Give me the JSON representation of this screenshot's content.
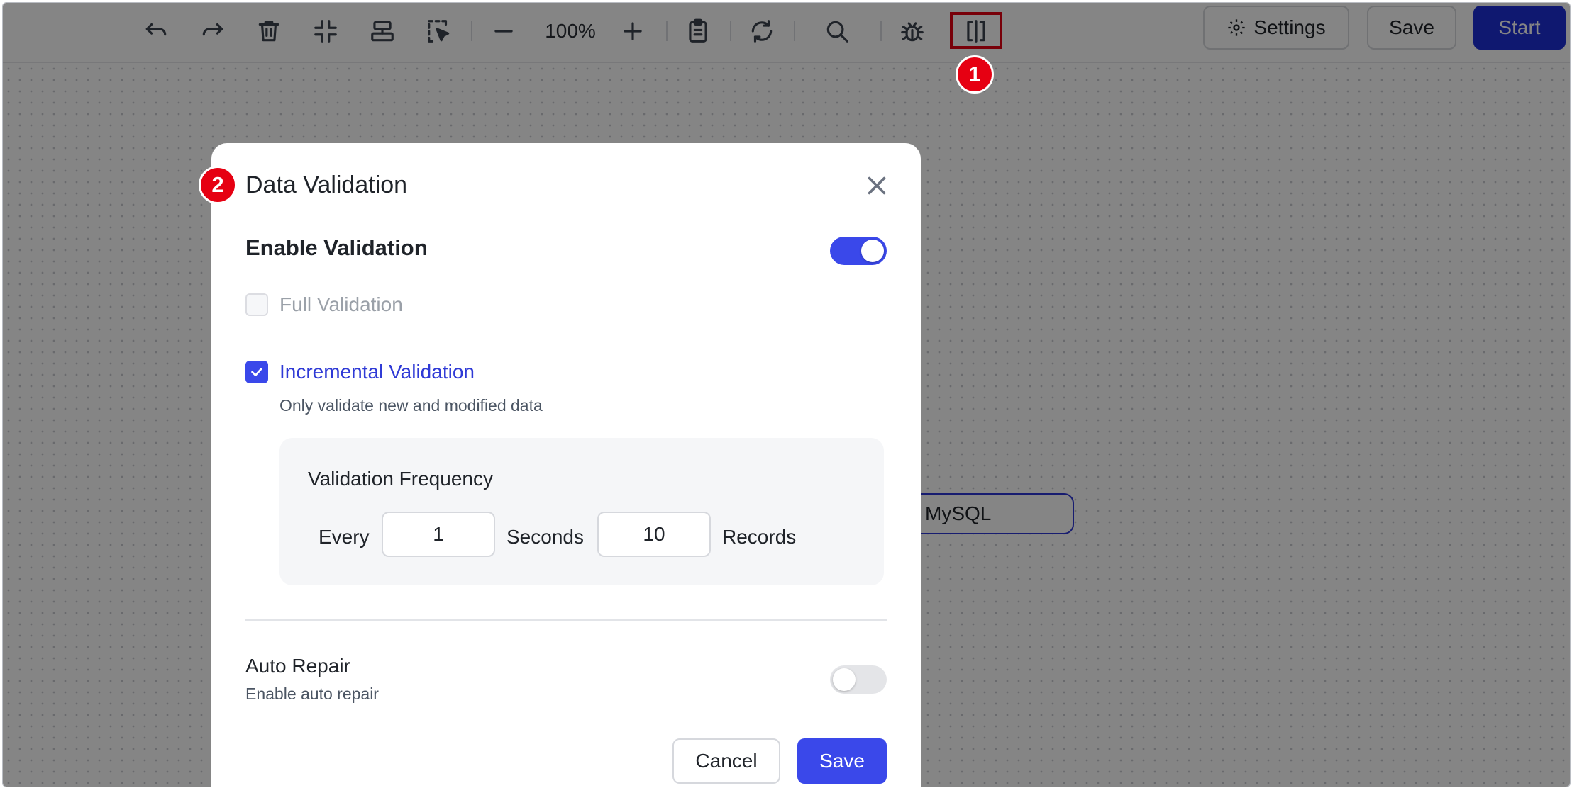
{
  "toolbar": {
    "icons": [
      "undo-icon",
      "redo-icon",
      "trash-icon",
      "collapse-icon",
      "align-icon",
      "select-icon",
      "zoom-out-icon",
      "zoom-in-icon",
      "clipboard-icon",
      "refresh-icon",
      "search-icon",
      "debug-icon",
      "split-view-icon"
    ],
    "zoom": "100%",
    "settings_label": "Settings",
    "save_label": "Save",
    "start_label": "Start"
  },
  "canvas": {
    "node_label": "MySQL"
  },
  "annotations": {
    "badge1": "1",
    "badge2": "2",
    "highlight_color": "#e60012"
  },
  "modal": {
    "title": "Data Validation",
    "enable_validation": {
      "label": "Enable Validation",
      "on": true
    },
    "full_validation": {
      "label": "Full Validation",
      "checked": false,
      "disabled": true
    },
    "incremental_validation": {
      "label": "Incremental Validation",
      "checked": true,
      "description": "Only validate new and modified data"
    },
    "frequency": {
      "title": "Validation Frequency",
      "every_label": "Every",
      "seconds_value": "1",
      "seconds_label": "Seconds",
      "records_value": "10",
      "records_label": "Records"
    },
    "auto_repair": {
      "label": "Auto Repair",
      "description": "Enable auto repair",
      "on": false
    },
    "cancel_label": "Cancel",
    "save_label": "Save"
  },
  "colors": {
    "accent": "#3a48ea",
    "primary_button": "#1d2fd6",
    "annotation_red": "#e60012"
  }
}
